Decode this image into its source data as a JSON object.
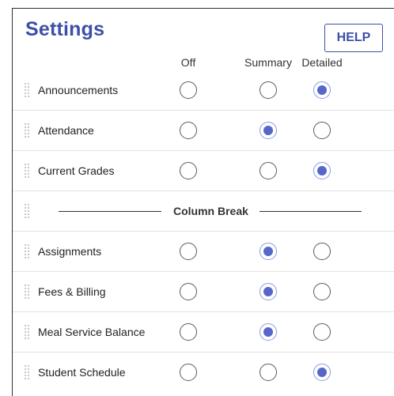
{
  "title": "Settings",
  "help_label": "HELP",
  "columns": [
    "Off",
    "Summary",
    "Detailed"
  ],
  "rows_before": [
    {
      "label": "Announcements",
      "selected": "Detailed"
    },
    {
      "label": "Attendance",
      "selected": "Summary"
    },
    {
      "label": "Current Grades",
      "selected": "Detailed"
    }
  ],
  "column_break_label": "Column Break",
  "rows_after": [
    {
      "label": "Assignments",
      "selected": "Summary"
    },
    {
      "label": "Fees & Billing",
      "selected": "Summary"
    },
    {
      "label": "Meal Service Balance",
      "selected": "Summary"
    },
    {
      "label": "Student Schedule",
      "selected": "Detailed"
    }
  ],
  "colors": {
    "accent": "#3d4fa8",
    "radio_selected": "#5667c9"
  }
}
